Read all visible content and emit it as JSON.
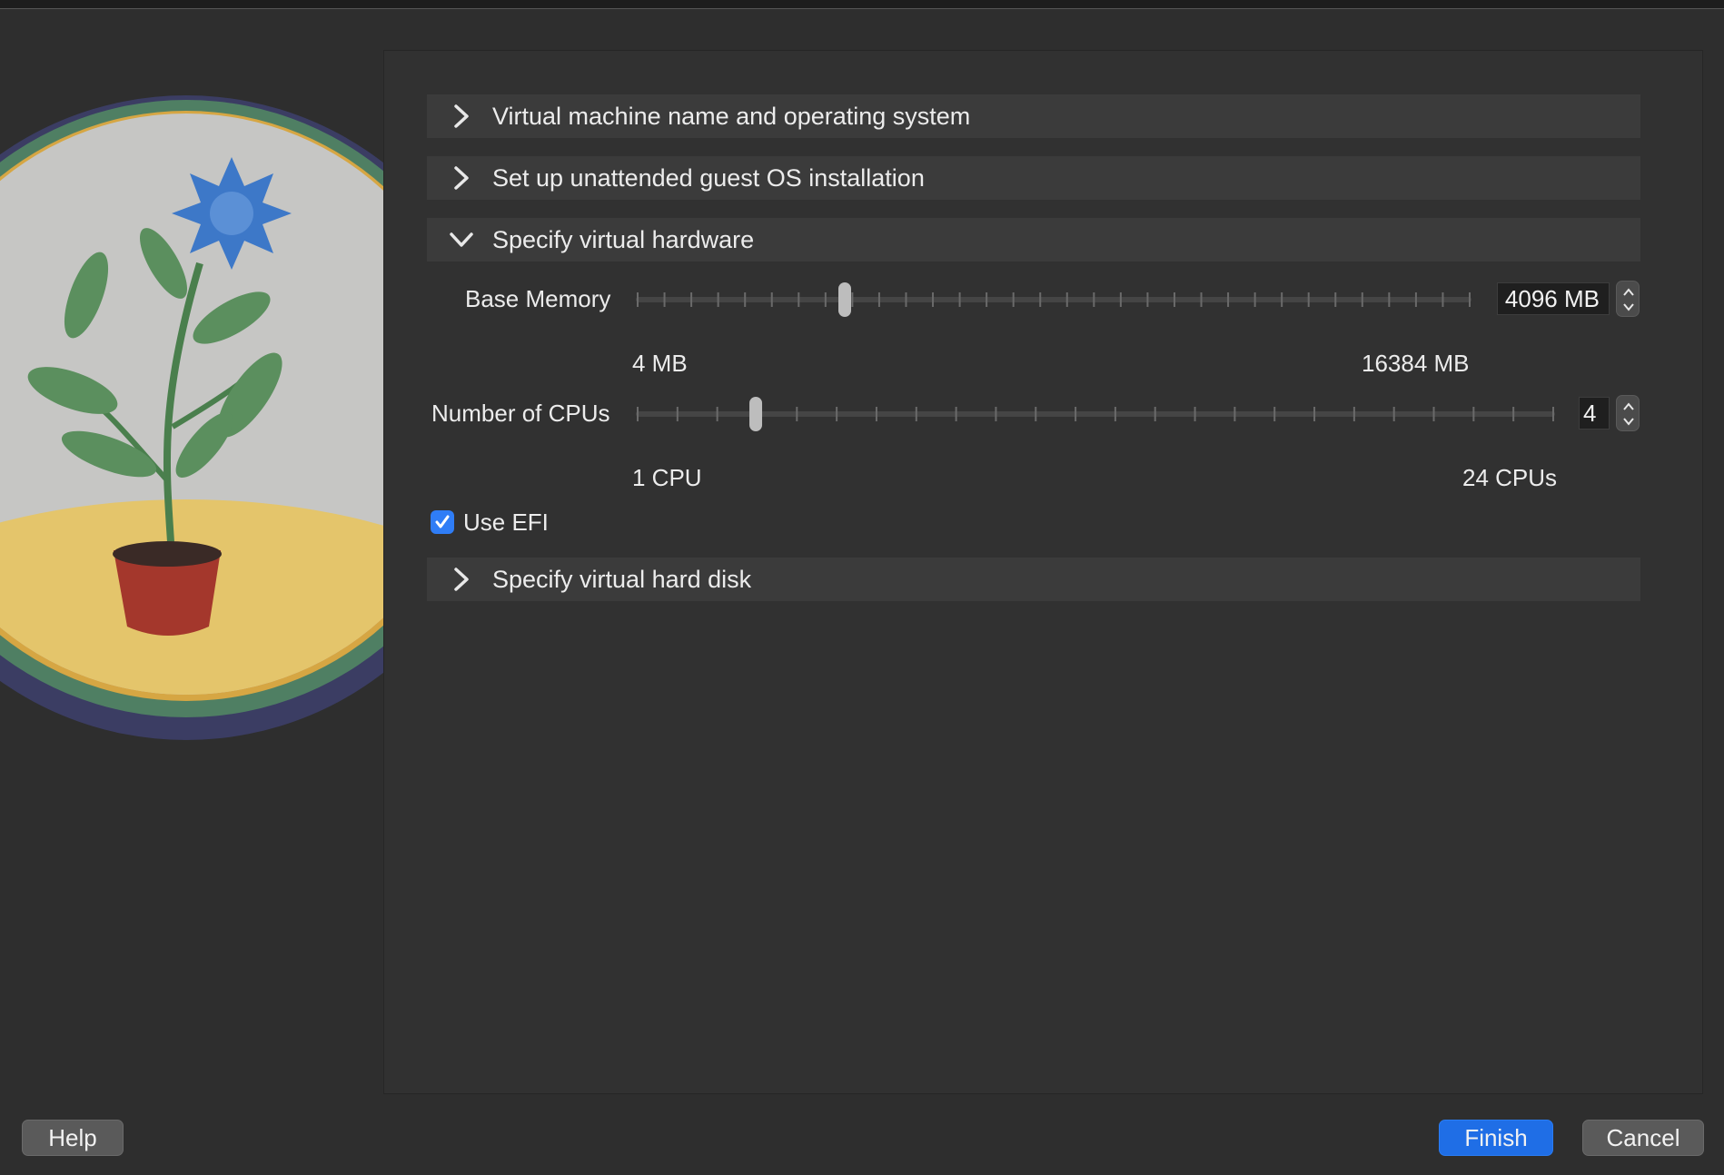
{
  "sections": [
    {
      "title": "Virtual machine name and operating system",
      "expanded": false
    },
    {
      "title": "Set up unattended guest OS installation",
      "expanded": false
    },
    {
      "title": "Specify virtual hardware",
      "expanded": true
    },
    {
      "title": "Specify virtual hard disk",
      "expanded": false
    }
  ],
  "hardware": {
    "memory": {
      "label": "Base Memory",
      "value": "4096 MB",
      "min_label": "4 MB",
      "max_label": "16384 MB",
      "fraction": 0.25
    },
    "cpus": {
      "label": "Number of CPUs",
      "value": "4",
      "min_label": "1 CPU",
      "max_label": "24 CPUs",
      "fraction": 0.13
    },
    "efi": {
      "label": "Use EFI",
      "checked": true
    }
  },
  "buttons": {
    "help": "Help",
    "finish": "Finish",
    "cancel": "Cancel"
  },
  "colors": {
    "accent": "#1f6ee6",
    "checkbox": "#2f7df6"
  }
}
